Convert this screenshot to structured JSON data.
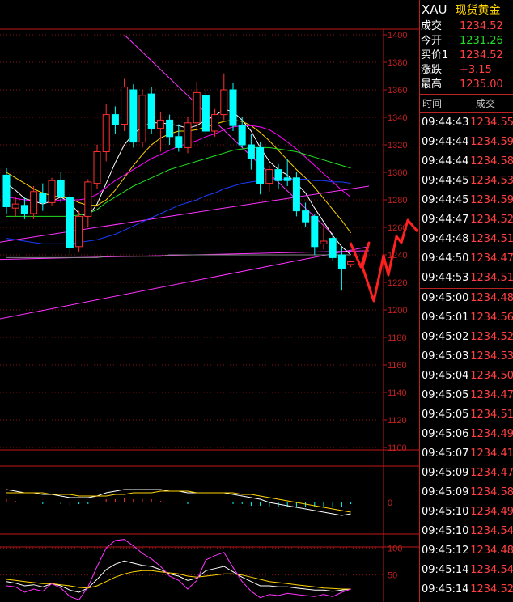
{
  "quote": {
    "symbol": "XAU",
    "name": "现货黄金",
    "rows": [
      {
        "label": "成交",
        "value": "1234.52",
        "color": "#ff4040"
      },
      {
        "label": "今开",
        "value": "1231.26",
        "color": "#22e022"
      },
      {
        "label": "买价1",
        "value": "1234.52",
        "color": "#ff4040"
      },
      {
        "label": "涨跌",
        "value": "+3.15",
        "color": "#ff4040"
      },
      {
        "label": "最高",
        "value": "1235.00",
        "color": "#ff4040"
      }
    ]
  },
  "ticks": {
    "header_time": "时间",
    "header_price": "成交",
    "rows": [
      {
        "time": "09:44:43",
        "price": "1234.55"
      },
      {
        "time": "09:44:44",
        "price": "1234.59"
      },
      {
        "time": "09:44:44",
        "price": "1234.58"
      },
      {
        "time": "09:44:45",
        "price": "1234.53"
      },
      {
        "time": "09:44:45",
        "price": "1234.59"
      },
      {
        "time": "09:44:47",
        "price": "1234.52"
      },
      {
        "time": "09:44:48",
        "price": "1234.51"
      },
      {
        "time": "09:44:50",
        "price": "1234.47"
      },
      {
        "time": "09:44:53",
        "price": "1234.51"
      },
      {
        "time": "09:45:00",
        "price": "1234.48"
      },
      {
        "time": "09:45:01",
        "price": "1234.56"
      },
      {
        "time": "09:45:02",
        "price": "1234.52"
      },
      {
        "time": "09:45:03",
        "price": "1234.53"
      },
      {
        "time": "09:45:04",
        "price": "1234.50"
      },
      {
        "time": "09:45:05",
        "price": "1234.47"
      },
      {
        "time": "09:45:05",
        "price": "1234.51"
      },
      {
        "time": "09:45:06",
        "price": "1234.49"
      },
      {
        "time": "09:45:07",
        "price": "1234.41"
      },
      {
        "time": "09:45:09",
        "price": "1234.47"
      },
      {
        "time": "09:45:09",
        "price": "1234.58"
      },
      {
        "time": "09:45:10",
        "price": "1234.49"
      },
      {
        "time": "09:45:10",
        "price": "1234.54"
      },
      {
        "time": "09:45:12",
        "price": "1234.48"
      },
      {
        "time": "09:45:14",
        "price": "1234.54"
      },
      {
        "time": "09:45:14",
        "price": "1234.52"
      }
    ]
  },
  "chart_data": {
    "type": "candlestick",
    "title": "",
    "price_axis": {
      "ticks": [
        1400,
        1380,
        1360,
        1340,
        1320,
        1300,
        1280,
        1260,
        1240,
        1220,
        1200,
        1180,
        1160,
        1140,
        1120,
        1100
      ],
      "range": [
        1100,
        1400
      ]
    },
    "macd_axis": {
      "ticks": [
        0
      ]
    },
    "kdj_axis": {
      "ticks": [
        100,
        50
      ],
      "range": [
        0,
        120
      ]
    },
    "candles": [
      {
        "o": 1298,
        "h": 1303,
        "l": 1270,
        "c": 1275
      },
      {
        "o": 1274,
        "h": 1282,
        "l": 1268,
        "c": 1277
      },
      {
        "o": 1276,
        "h": 1282,
        "l": 1266,
        "c": 1270
      },
      {
        "o": 1270,
        "h": 1290,
        "l": 1266,
        "c": 1286
      },
      {
        "o": 1285,
        "h": 1292,
        "l": 1272,
        "c": 1278
      },
      {
        "o": 1278,
        "h": 1296,
        "l": 1276,
        "c": 1294
      },
      {
        "o": 1294,
        "h": 1300,
        "l": 1278,
        "c": 1282
      },
      {
        "o": 1282,
        "h": 1284,
        "l": 1240,
        "c": 1245
      },
      {
        "o": 1246,
        "h": 1272,
        "l": 1242,
        "c": 1268
      },
      {
        "o": 1268,
        "h": 1295,
        "l": 1260,
        "c": 1293
      },
      {
        "o": 1292,
        "h": 1320,
        "l": 1288,
        "c": 1315
      },
      {
        "o": 1315,
        "h": 1350,
        "l": 1308,
        "c": 1342
      },
      {
        "o": 1342,
        "h": 1348,
        "l": 1328,
        "c": 1335
      },
      {
        "o": 1335,
        "h": 1368,
        "l": 1330,
        "c": 1362
      },
      {
        "o": 1360,
        "h": 1364,
        "l": 1318,
        "c": 1322
      },
      {
        "o": 1322,
        "h": 1360,
        "l": 1318,
        "c": 1356
      },
      {
        "o": 1357,
        "h": 1362,
        "l": 1328,
        "c": 1332
      },
      {
        "o": 1332,
        "h": 1344,
        "l": 1315,
        "c": 1338
      },
      {
        "o": 1338,
        "h": 1342,
        "l": 1320,
        "c": 1326
      },
      {
        "o": 1326,
        "h": 1335,
        "l": 1315,
        "c": 1318
      },
      {
        "o": 1318,
        "h": 1340,
        "l": 1314,
        "c": 1336
      },
      {
        "o": 1336,
        "h": 1366,
        "l": 1330,
        "c": 1358
      },
      {
        "o": 1356,
        "h": 1360,
        "l": 1328,
        "c": 1330
      },
      {
        "o": 1330,
        "h": 1346,
        "l": 1326,
        "c": 1342
      },
      {
        "o": 1342,
        "h": 1372,
        "l": 1338,
        "c": 1360
      },
      {
        "o": 1360,
        "h": 1365,
        "l": 1330,
        "c": 1334
      },
      {
        "o": 1334,
        "h": 1340,
        "l": 1318,
        "c": 1320
      },
      {
        "o": 1320,
        "h": 1328,
        "l": 1302,
        "c": 1310
      },
      {
        "o": 1318,
        "h": 1322,
        "l": 1284,
        "c": 1292
      },
      {
        "o": 1292,
        "h": 1305,
        "l": 1286,
        "c": 1302
      },
      {
        "o": 1302,
        "h": 1306,
        "l": 1288,
        "c": 1294
      },
      {
        "o": 1296,
        "h": 1310,
        "l": 1290,
        "c": 1294
      },
      {
        "o": 1296,
        "h": 1300,
        "l": 1268,
        "c": 1272
      },
      {
        "o": 1272,
        "h": 1278,
        "l": 1260,
        "c": 1264
      },
      {
        "o": 1268,
        "h": 1270,
        "l": 1240,
        "c": 1246
      },
      {
        "o": 1248,
        "h": 1262,
        "l": 1244,
        "c": 1250
      },
      {
        "o": 1252,
        "h": 1256,
        "l": 1236,
        "c": 1238
      },
      {
        "o": 1240,
        "h": 1246,
        "l": 1214,
        "c": 1230
      },
      {
        "o": 1233,
        "h": 1236,
        "l": 1231,
        "c": 1235
      }
    ],
    "ma_series": [
      {
        "color": "#ffffff",
        "values": [
          1292,
          1287,
          1281,
          1279,
          1277,
          1279,
          1282,
          1278,
          1270,
          1268,
          1277,
          1292,
          1307,
          1320,
          1328,
          1333,
          1336,
          1336,
          1335,
          1334,
          1332,
          1334,
          1338,
          1341,
          1346,
          1344,
          1338,
          1330,
          1318,
          1308,
          1302,
          1298,
          1292,
          1285,
          1274,
          1264,
          1254,
          1246,
          1240
        ]
      },
      {
        "color": "#ffd400",
        "values": [
          1300,
          1296,
          1292,
          1288,
          1285,
          1283,
          1282,
          1281,
          1278,
          1276,
          1276,
          1280,
          1287,
          1296,
          1305,
          1313,
          1320,
          1325,
          1328,
          1330,
          1330,
          1331,
          1333,
          1335,
          1337,
          1338,
          1337,
          1334,
          1329,
          1323,
          1316,
          1309,
          1302,
          1296,
          1289,
          1281,
          1273,
          1265,
          1256
        ]
      },
      {
        "color": "#ff00ff",
        "values": [
          1282,
          1281,
          1280,
          1279,
          1279,
          1279,
          1280,
          1280,
          1280,
          1281,
          1284,
          1289,
          1294,
          1298,
          1302,
          1306,
          1310,
          1313,
          1316,
          1319,
          1321,
          1323,
          1326,
          1328,
          1331,
          1333,
          1334,
          1334,
          1333,
          1331,
          1327,
          1322,
          1317,
          1311,
          1305,
          1299,
          1293,
          1287,
          1282
        ]
      },
      {
        "color": "#22e022",
        "values": [
          1268,
          1268,
          1268,
          1268,
          1268,
          1268,
          1268,
          1268,
          1269,
          1270,
          1273,
          1278,
          1282,
          1286,
          1290,
          1293,
          1296,
          1299,
          1302,
          1304,
          1306,
          1308,
          1310,
          1312,
          1314,
          1316,
          1317,
          1318,
          1318,
          1318,
          1317,
          1316,
          1315,
          1313,
          1311,
          1309,
          1307,
          1305,
          1303
        ]
      },
      {
        "color": "#1a3cff",
        "values": [
          1252,
          1251,
          1250,
          1249,
          1248,
          1248,
          1248,
          1248,
          1249,
          1250,
          1251,
          1253,
          1255,
          1258,
          1261,
          1264,
          1267,
          1270,
          1273,
          1276,
          1278,
          1280,
          1283,
          1285,
          1288,
          1290,
          1292,
          1293,
          1294,
          1295,
          1295,
          1295,
          1295,
          1295,
          1294,
          1294,
          1293,
          1293,
          1292
        ]
      },
      {
        "color": "#888888",
        "values": [
          1238,
          1238,
          1238,
          1238,
          1238,
          1238,
          1238,
          1238,
          1238,
          1238,
          1238,
          1239,
          1239,
          1239,
          1239,
          1239,
          1239,
          1239,
          1240,
          1240,
          1240,
          1240,
          1240,
          1240,
          1240,
          1240,
          1240,
          1240,
          1240,
          1240,
          1240,
          1240,
          1240,
          1240,
          1240,
          1240,
          1240,
          1240,
          1240
        ]
      }
    ],
    "trend_lines": [
      {
        "from": [
          13,
          1400
        ],
        "to": [
          36,
          1255
        ]
      },
      {
        "from": [
          -5,
          1245
        ],
        "to": [
          40,
          1290
        ]
      },
      {
        "from": [
          -5,
          1188
        ],
        "to": [
          40,
          1246
        ]
      },
      {
        "from": [
          -5,
          1236
        ],
        "to": [
          40,
          1243
        ]
      }
    ],
    "macd": {
      "dif": [
        0.8,
        0.7,
        0.6,
        0.6,
        0.5,
        0.5,
        0.4,
        0.3,
        0.3,
        0.3,
        0.4,
        0.6,
        0.7,
        0.8,
        0.8,
        0.8,
        0.8,
        0.8,
        0.7,
        0.7,
        0.6,
        0.6,
        0.6,
        0.6,
        0.6,
        0.5,
        0.4,
        0.3,
        0.2,
        0.0,
        -0.1,
        -0.2,
        -0.3,
        -0.4,
        -0.5,
        -0.6,
        -0.7,
        -0.8,
        -0.7
      ],
      "dea": [
        0.6,
        0.6,
        0.6,
        0.6,
        0.6,
        0.5,
        0.5,
        0.5,
        0.4,
        0.4,
        0.4,
        0.4,
        0.5,
        0.5,
        0.6,
        0.6,
        0.6,
        0.7,
        0.7,
        0.7,
        0.7,
        0.6,
        0.6,
        0.6,
        0.6,
        0.6,
        0.5,
        0.5,
        0.4,
        0.3,
        0.2,
        0.1,
        0.0,
        -0.1,
        -0.2,
        -0.3,
        -0.4,
        -0.5,
        -0.6
      ],
      "hist": [
        0.2,
        0.1,
        0.0,
        0.0,
        -0.1,
        0.0,
        -0.1,
        -0.2,
        -0.1,
        -0.1,
        0.0,
        0.2,
        0.2,
        0.3,
        0.2,
        0.2,
        0.2,
        0.1,
        0.0,
        0.0,
        -0.1,
        0.0,
        0.0,
        0.0,
        0.0,
        -0.1,
        -0.1,
        -0.2,
        -0.2,
        -0.3,
        -0.3,
        -0.3,
        -0.3,
        -0.3,
        -0.3,
        -0.3,
        -0.3,
        -0.3,
        -0.1
      ]
    },
    "kdj": {
      "k": [
        38,
        35,
        30,
        32,
        28,
        34,
        30,
        22,
        18,
        26,
        42,
        60,
        70,
        76,
        72,
        68,
        66,
        60,
        52,
        48,
        40,
        44,
        58,
        62,
        66,
        56,
        46,
        38,
        30,
        30,
        28,
        28,
        26,
        24,
        22,
        22,
        20,
        22,
        24
      ],
      "d": [
        42,
        40,
        38,
        36,
        34,
        34,
        32,
        30,
        27,
        26,
        30,
        38,
        46,
        52,
        56,
        58,
        58,
        56,
        54,
        52,
        48,
        46,
        48,
        50,
        52,
        52,
        50,
        46,
        42,
        38,
        36,
        34,
        32,
        30,
        28,
        26,
        25,
        24,
        24
      ],
      "j": [
        30,
        28,
        18,
        24,
        20,
        34,
        26,
        10,
        4,
        28,
        66,
        100,
        114,
        116,
        104,
        90,
        80,
        66,
        48,
        40,
        24,
        40,
        78,
        86,
        92,
        64,
        38,
        20,
        8,
        14,
        12,
        16,
        14,
        12,
        10,
        14,
        10,
        18,
        24
      ]
    }
  }
}
